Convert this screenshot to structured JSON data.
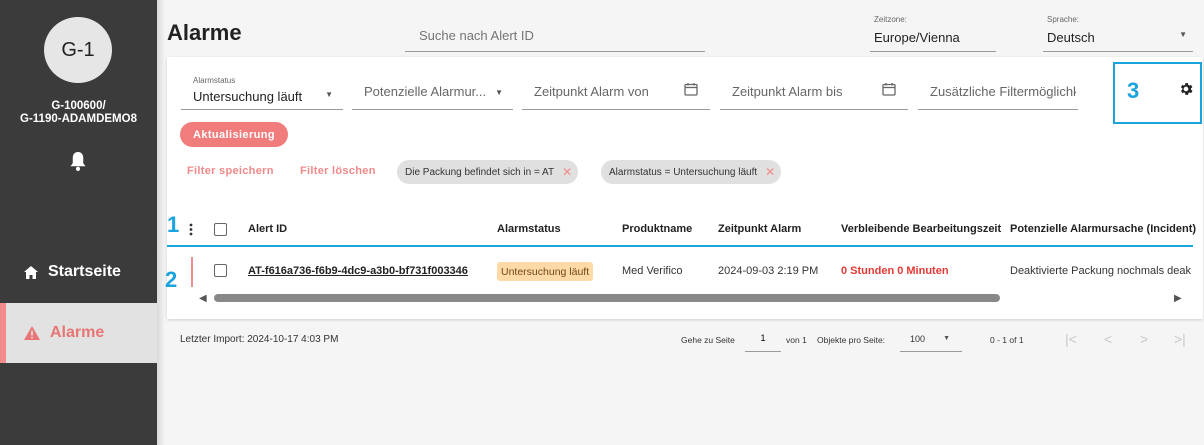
{
  "sidebar": {
    "avatar_text": "G-1",
    "account_line1": "G-100600/",
    "account_line2": "G-1190-ADAMDEMO8",
    "bell_icon": "bell-icon",
    "nav": {
      "home": {
        "label": "Startseite",
        "icon": "home-icon"
      },
      "alarms": {
        "label": "Alarme",
        "icon": "warning-icon",
        "active": true
      }
    }
  },
  "header": {
    "title": "Alarme",
    "search_placeholder": "Suche nach Alert ID",
    "timezone": {
      "label": "Zeitzone:",
      "value": "Europe/Vienna"
    },
    "language": {
      "label": "Sprache:",
      "value": "Deutsch"
    }
  },
  "filters": {
    "alarm_status": {
      "label": "Alarmstatus",
      "value": "Untersuchung läuft"
    },
    "potential_cause": {
      "placeholder": "Potenzielle Alarmur..."
    },
    "time_from": {
      "placeholder": "Zeitpunkt Alarm von"
    },
    "time_to": {
      "placeholder": "Zeitpunkt Alarm bis"
    },
    "additional": {
      "placeholder": "Zusätzliche Filtermöglichk"
    },
    "refresh_label": "Aktualisierung",
    "save_filter_label": "Filter speichern",
    "clear_filter_label": "Filter löschen",
    "chips": [
      {
        "label": "Die Packung befindet sich in = AT"
      },
      {
        "label": "Alarmstatus = Untersuchung läuft"
      }
    ]
  },
  "annotations": {
    "m1": "1",
    "m2": "2",
    "m3": "3"
  },
  "table": {
    "columns": [
      "Alert ID",
      "Alarmstatus",
      "Produktname",
      "Zeitpunkt Alarm",
      "Verbleibende Bearbeitungszeit",
      "Potenzielle Alarmursache (Incident)"
    ],
    "rows": [
      {
        "alert_id": "AT-f616a736-f6b9-4dc9-a3b0-bf731f003346",
        "status": "Untersuchung läuft",
        "product": "Med Verifico",
        "time": "2024-09-03 2:19 PM",
        "remaining": "0 Stunden 0 Minuten",
        "cause": "Deaktivierte Packung nochmals deak"
      }
    ]
  },
  "footer": {
    "last_import": "Letzter Import: 2024-10-17 4:03 PM",
    "goto_label": "Gehe zu Seite",
    "page_value": "1",
    "of_label": "von 1",
    "per_page_label": "Objekte pro Seite:",
    "per_page_value": "100",
    "range": "0 - 1 of 1"
  },
  "colors": {
    "accent": "#f07c7c",
    "annotation": "#1aa3dd",
    "sidebar": "#3b3b3b"
  }
}
